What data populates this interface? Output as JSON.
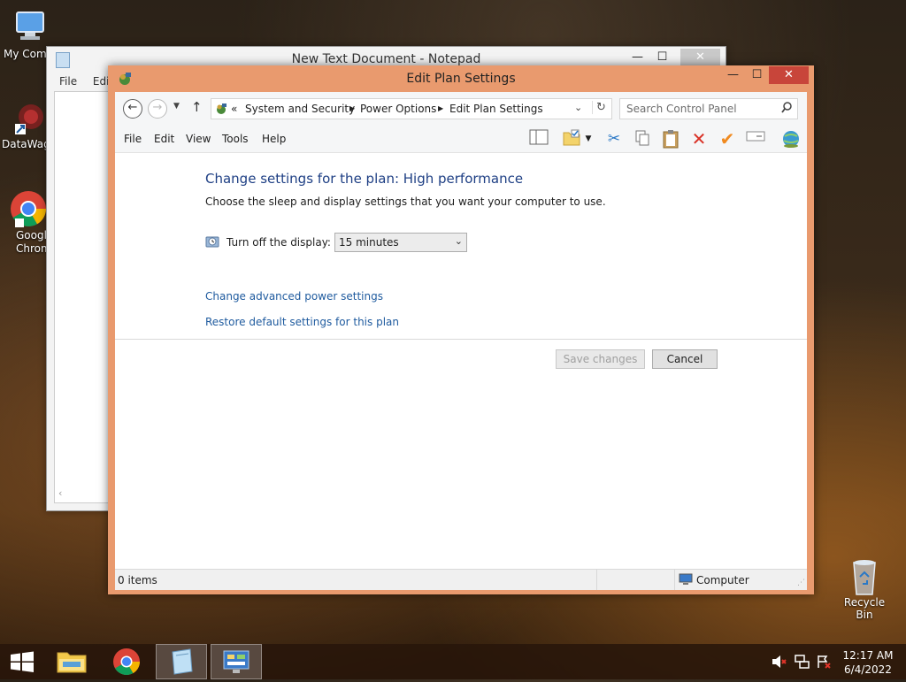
{
  "desktop": {
    "icons": [
      {
        "label": "My Comp"
      },
      {
        "label": "DataWag"
      },
      {
        "label": "Googl\nChrom"
      },
      {
        "label": "Recycle Bin"
      }
    ]
  },
  "notepad": {
    "title": "New Text Document - Notepad",
    "menu": [
      "File",
      "Edit"
    ]
  },
  "window": {
    "title": "Edit Plan Settings",
    "breadcrumb": {
      "prefix": "«",
      "items": [
        "System and Security",
        "Power Options",
        "Edit Plan Settings"
      ]
    },
    "search_placeholder": "Search Control Panel",
    "menu": [
      "File",
      "Edit",
      "View",
      "Tools",
      "Help"
    ],
    "heading": "Change settings for the plan: High performance",
    "subtitle": "Choose the sleep and display settings that you want your computer to use.",
    "display_label": "Turn off the display:",
    "display_value": "15 minutes",
    "links": {
      "advanced": "Change advanced power settings",
      "restore": "Restore default settings for this plan"
    },
    "buttons": {
      "save": "Save changes",
      "cancel": "Cancel"
    },
    "status": {
      "items": "0 items",
      "location": "Computer"
    },
    "accent_color": "#e99a6e"
  },
  "taskbar": {
    "time": "12:17 AM",
    "date": "6/4/2022"
  }
}
